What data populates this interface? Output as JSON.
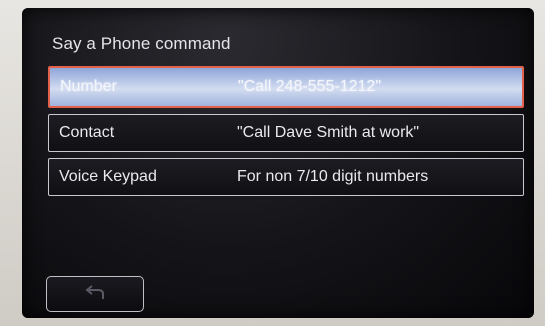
{
  "screen": {
    "prompt": "Say a Phone command"
  },
  "menu": {
    "items": [
      {
        "label": "Number",
        "example": "\"Call 248-555-1212\"",
        "selected": true
      },
      {
        "label": "Contact",
        "example": "\"Call Dave Smith at work\"",
        "selected": false
      },
      {
        "label": "Voice Keypad",
        "example": "For non 7/10 digit numbers",
        "selected": false
      }
    ]
  },
  "footer": {
    "back_icon": "back-arrow-icon"
  },
  "colors": {
    "selection_border": "#e3614a",
    "selection_fill": "#b9c8e8",
    "row_border": "#c9c9d2",
    "screen_bg": "#141418"
  }
}
